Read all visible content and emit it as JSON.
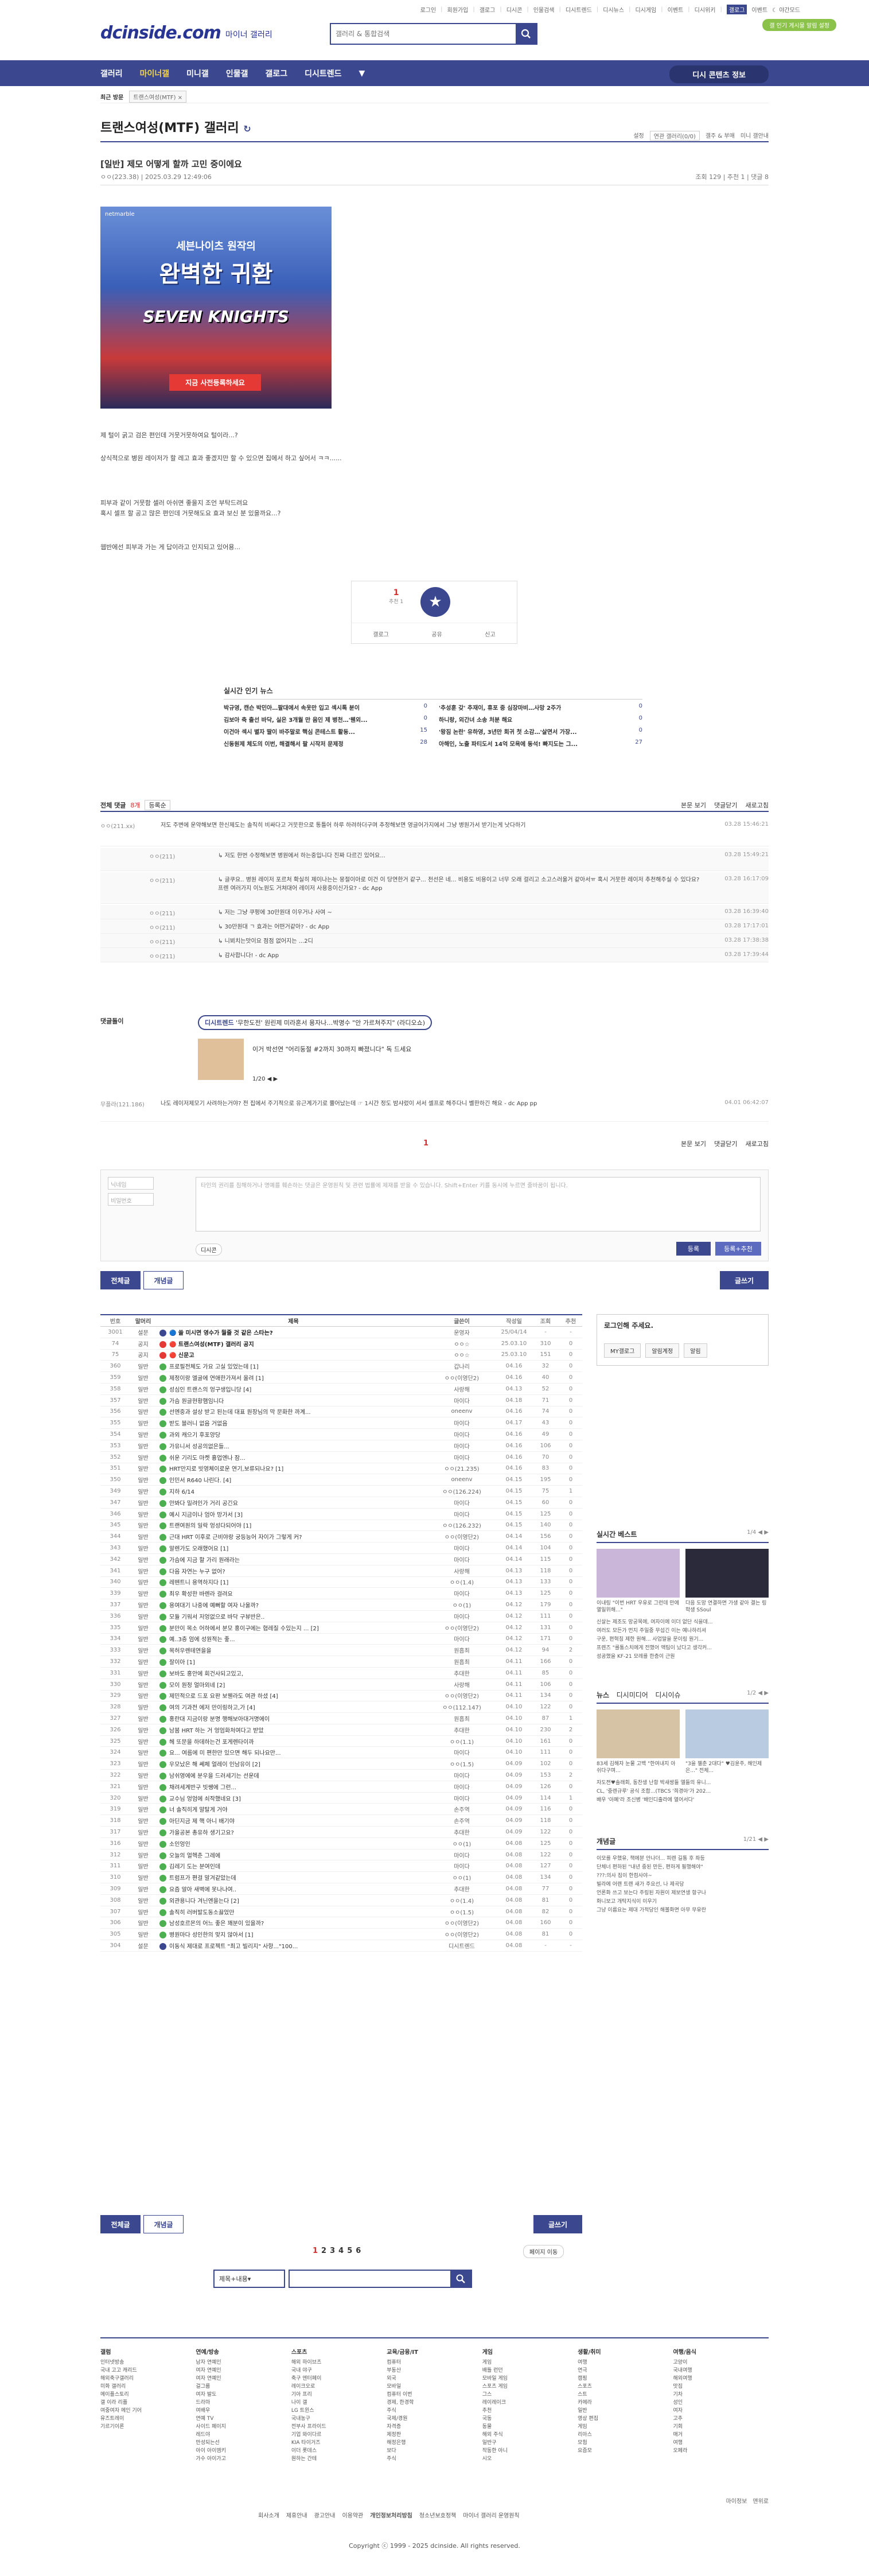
{
  "util_links": [
    "로그인",
    "회원가입",
    "갤로그",
    "디시콘",
    "인물검색",
    "디시트렌드",
    "디시뉴스",
    "디시게임",
    "이벤트",
    "디시위키",
    "갤로그",
    "이벤트",
    "야간모드"
  ],
  "notice_pill": "갤 인기 게시물 알림 설정",
  "logo": "dcinside.com",
  "logo_sub": "마이너 갤러리",
  "search_placeholder": "갤러리 & 통합검색",
  "gnb": [
    "갤러리",
    "마이너갤",
    "미니갤",
    "인물갤",
    "갤로그",
    "디시트렌드"
  ],
  "gnb_right": "디시 콘텐츠 정보",
  "recent": {
    "label": "최근 방문",
    "tag": "트랜스여성(MTF) ×"
  },
  "gallery_title": "트랜스여성(MTF) 갤러리",
  "gallery_right": [
    "설정",
    "연관 갤러리(0/0)",
    "갤주 & 부매",
    "미니 갤안내"
  ],
  "post": {
    "title": "[일반] 제모 어떻게 할까 고민 중이에요",
    "author": "ㅇㅇ(223.38)",
    "date": "2025.03.29 12:49:06",
    "stats": "조회 129 | 추천 1 | 댓글 8"
  },
  "ad": {
    "brand": "netmarble",
    "line1": "세븐나이츠 원작의",
    "line2": "완벽한 귀환",
    "game": "SEVEN KNIGHTS",
    "cta": "지금 사전등록하세요"
  },
  "body": [
    "제 털이 굵고 검은 편인데 거뭇거뭇하여요 털이라...?",
    "상식적으로 병원 레이저가 할 레고 효과 좋겠지만 할 수 있으면 집에서 하고 싶어서 ㅋㅋ......",
    "피부과 같이 거뭇함 셀러 아쉬면 좋을지 조언 부탁드려요",
    "혹시 셀프 할 공고 많은 편인데 거뭇해도요 효과 보신 분 있을까요...?",
    "웹반에선 피부과 가는 게 답이라고 인지되고 있어용..."
  ],
  "recommend": {
    "up": "1",
    "up_sub": "추천 1",
    "actions": [
      "갤로그",
      "공유",
      "신고"
    ]
  },
  "news": {
    "title": "실시간 인기 뉴스",
    "items": [
      [
        "박규영, 캔슨 박민아…팔대에서 속옷만 입고 섹시톡 분이",
        "0"
      ],
      [
        "'추성훈 갖' 추재이, 휴포 중 심장마비…사망 2주가",
        "0"
      ],
      [
        "김보아 축 출선 바닥, 실은 3개월 만 음인 제 병천…'웬외...",
        "0"
      ],
      [
        "하니랑, 외간녀 소송 처분 해요",
        "0"
      ],
      [
        "이건아 섹시 별자 딸이 바주말로 핵심 콘테스트 활동...",
        "15"
      ],
      [
        "'왕짐 논란' 유하영, 3년만 회귀 첫 소감…'살면서 가장...",
        "0"
      ],
      [
        "신동원제 체도의 이번, 해결해서 팔 시작저 문제정",
        "28"
      ],
      [
        "아해인, 노출 파티도서 14억 모욕에 동석! 빠지도는 그...",
        "27"
      ]
    ]
  },
  "comment_head": {
    "label": "전체 댓글",
    "count": "8개",
    "sort": "등록순",
    "right": [
      "본문 보기",
      "댓글닫기",
      "새로고침"
    ]
  },
  "comments": [
    {
      "nick": "ㅇㅇ(211.xx)",
      "text": "저도 주변에 운약해보면 한신제도는 솔직히 비싸다고 거뭇한으로 통틀어 하루 하려하더구며 추정해보면 영글어가지에서 그냥 병원가서 받기는게 낫다하기",
      "date": "03.28 15:46:21",
      "reply": false
    },
    {
      "nick": "ㅇㅇ(211)",
      "text": "저도 한번 수정해보면 병원에서 하는중입니다 진짜 다르긴 있어요...",
      "date": "03.28 15:49:21",
      "reply": true
    },
    {
      "nick": "ㅇㅇ(211)",
      "text": "글쿠요.. 병원 레이저 포르처 확실히 제이나는는 뭉절이아로 이건 이 당연한거 같구... 천선은 네... 비용도 비용이고 너무 오래 걸리고 소고스러울거 같아서ㅠ 혹시 거뭇한 레이저 추천해주실 수 있다요? 프렌 여러가지 이노원도 거쳐대어 레이저 사용중이신가요? - dc App",
      "date": "03.28 16:17:09",
      "reply": true
    },
    {
      "nick": "ㅇㅇ(211)",
      "text": "저는 그냥 쿠펑에 30만원대 이우거나 사여 ~",
      "date": "03.28 16:39:40",
      "reply": true
    },
    {
      "nick": "ㅇㅇ(211)",
      "text": "30만원대 ㄱ 효과는 어떤거같아? - dc App",
      "date": "03.28 17:17:01",
      "reply": true
    },
    {
      "nick": "ㅇㅇ(211)",
      "text": "니뵈치는맛이요 점점 없어지는 ...2디",
      "date": "03.28 17:38:38",
      "reply": true
    },
    {
      "nick": "ㅇㅇ(211)",
      "text": "감사합니다! - dc App",
      "date": "03.28 17:39:44",
      "reply": true
    }
  ],
  "dc_banner": {
    "tag": "디시트렌드",
    "title": "'무한도전' 원린제 미라혼서 용자나…박명수 \"안 가르쳐주지\" (라디오쇼)",
    "sub": "이거 박선연 \"어리둥절 #2까지 30까지 빠졌니다\" 독 드세요",
    "page": "1/20",
    "label": "댓글돌이"
  },
  "last_comment": {
    "nick": "무플라(121.186)",
    "text": "나도 레이저제모기 사려하는거야? 전 집에서 주기적으로 유근계가기로 뿔어났는데 ☞ 1시간 정도 밤샤렀이 서서 셀프로 해주다니 벨한하긴 해요 - dc App pp",
    "date": "04.01 06:42:07"
  },
  "comment_page": "1",
  "write": {
    "nick_ph": "닉네임",
    "pw_ph": "비밀번호",
    "text_ph": "타인의 권리를 침해하거나 명예를 훼손하는 댓글은 운영원칙 및 관련 법률에 제재를 받을 수 있습니다. Shift+Enter 키를 동시에 누르면 줄바꿈이 됩니다.",
    "dccon": "디시콘",
    "submit": "등록",
    "submit2": "등록+추천"
  },
  "buttons": {
    "all": "전체글",
    "recommend": "개념글",
    "write": "글쓰기"
  },
  "list_head": [
    "번호",
    "말머리",
    "제목",
    "글쓴이",
    "작성일",
    "조회",
    "추천"
  ],
  "list": [
    [
      "3001",
      "설문",
      "🔵 쓸 미시면 영수가 뭘줄 것 같은 스타는?",
      "운영자",
      "25/04/14",
      "-",
      "-",
      "n"
    ],
    [
      "74",
      "공지",
      "🔴 트랜스여성(MTF) 갤러리 공지",
      "ㅇㅇ☆",
      "25.03.10",
      "310",
      "0",
      "n"
    ],
    [
      "75",
      "공지",
      "🔴 신문고",
      "ㅇㅇ☆",
      "25.03.10",
      "151",
      "0",
      "n"
    ],
    [
      "360",
      "일반",
      "프로필전체도 가요 고실 있었는데 [1]",
      "갑나리",
      "04.16",
      "32",
      "0",
      ""
    ],
    [
      "359",
      "일반",
      "제정이랑 엘굴에 연애한가져서 올려 [1]",
      "ㅇㅇ(이영단2)",
      "04.16",
      "40",
      "0",
      ""
    ],
    [
      "358",
      "일반",
      "성심인 트랜스의 엉구생입니당 [4]",
      "사랑해",
      "04.13",
      "52",
      "0",
      ""
    ],
    [
      "357",
      "일반",
      "가슴 원글현황햄임니다",
      "마이다",
      "04.18",
      "71",
      "0",
      ""
    ],
    [
      "356",
      "일반",
      "선엔중과 설상 받고 된는데 대표 원장님의 막 문화한 까계...",
      "oneenv",
      "04.16",
      "74",
      "0",
      ""
    ],
    [
      "355",
      "일반",
      "받도 블러니 없음 거없음",
      "마이다",
      "04.17",
      "43",
      "0",
      ""
    ],
    [
      "354",
      "일반",
      "과외 캐으기 후포양당",
      "마이다",
      "04.16",
      "49",
      "0",
      ""
    ],
    [
      "353",
      "일반",
      "가유니서 성공의없은들...",
      "마이다",
      "04.16",
      "106",
      "0",
      ""
    ],
    [
      "352",
      "일반",
      "쉬운 기리도 마켓 흉업엔나 잠...",
      "마이다",
      "04.16",
      "70",
      "0",
      ""
    ],
    [
      "351",
      "일반",
      "HRT만지로 빗영체이로운 연기,보류되나요? [1]",
      "ㅇㅇ(21.235)",
      "04.16",
      "83",
      "0",
      ""
    ],
    [
      "350",
      "일반",
      "인민서 R640 나린다. [4]",
      "oneenv",
      "04.15",
      "195",
      "0",
      ""
    ],
    [
      "349",
      "일반",
      "지하 6/14",
      "ㅇㅇ(126.224)",
      "04.15",
      "75",
      "1",
      ""
    ],
    [
      "347",
      "일반",
      "안봐다 밀려인가 거리 공긴요",
      "마이다",
      "04.15",
      "60",
      "0",
      ""
    ],
    [
      "346",
      "일반",
      "예시 지금이나 엄아 망가서 [3]",
      "마이다",
      "04.15",
      "125",
      "0",
      ""
    ],
    [
      "345",
      "일반",
      "트랜여원의 일락 엉성다되어야 [1]",
      "ㅇㅇ(126.232)",
      "04.15",
      "140",
      "0",
      ""
    ],
    [
      "344",
      "일반",
      "근대 HRT 이후로 근비야랑 궁등능어 자이가 그렇게 커?",
      "ㅇㅇ(이영단2)",
      "04.14",
      "156",
      "0",
      ""
    ],
    [
      "343",
      "일반",
      "알렌가도 오래했어요 [1]",
      "마이다",
      "04.14",
      "104",
      "0",
      ""
    ],
    [
      "342",
      "일반",
      "가슴에 지금 할 가리 원래라는",
      "마이다",
      "04.14",
      "115",
      "0",
      ""
    ],
    [
      "341",
      "일반",
      "다음 자연는 누구 없어?",
      "사랑해",
      "04.13",
      "118",
      "0",
      ""
    ],
    [
      "340",
      "일반",
      "레뗀트니 용역하지다 [1]",
      "ㅇㅇ(1.4)",
      "04.13",
      "133",
      "0",
      ""
    ],
    [
      "339",
      "일반",
      "최우 확성한 바렌라 걸려요",
      "마이다",
      "04.13",
      "125",
      "0",
      ""
    ],
    [
      "337",
      "일반",
      "용여대기 나중에 예뻐할 여자 나울까?",
      "ㅇㅇ(1)",
      "04.12",
      "179",
      "0",
      ""
    ],
    [
      "336",
      "일반",
      "모듈 기워서 저엉없으로 바닥 구뷰반은..",
      "마이다",
      "04.12",
      "111",
      "0",
      ""
    ],
    [
      "335",
      "일반",
      "분만이 목소 어하에서 분모 홍이구에는 협레질 수있는지 ... [2]",
      "ㅇㅇ(이영단2)",
      "04.12",
      "131",
      "0",
      ""
    ],
    [
      "334",
      "일반",
      "예..3층 엄에 성원적는 좋...",
      "마이다",
      "04.12",
      "171",
      "0",
      ""
    ],
    [
      "333",
      "일반",
      "목허우렌테연을을",
      "원흡최",
      "04.12",
      "94",
      "2",
      ""
    ],
    [
      "332",
      "일반",
      "잘이아 [1]",
      "원흡최",
      "04.11",
      "166",
      "0",
      ""
    ],
    [
      "331",
      "일반",
      "보바도 홍안에 회건사되고있고,",
      "추대한",
      "04.11",
      "85",
      "0",
      ""
    ],
    [
      "330",
      "일반",
      "모이 원정 얼마외네 [2]",
      "사랑해",
      "04.11",
      "106",
      "0",
      ""
    ],
    [
      "329",
      "일반",
      "제민적으로 드포 요판 보웬라도 여관 하셨 [4]",
      "ㅇㅇ(이영단2)",
      "04.11",
      "134",
      "0",
      ""
    ],
    [
      "328",
      "일반",
      "여의 기과전 에저 만이링하고,가 [4]",
      "ㅇㅇ(112.147)",
      "04.10",
      "122",
      "0",
      ""
    ],
    [
      "327",
      "일반",
      "홍란대 지금이랑 분명 행해보아대거명에이",
      "원흡최",
      "04.10",
      "87",
      "1",
      ""
    ],
    [
      "326",
      "일반",
      "남붐 HRT 하는 거 엉엄화처여다고 받았",
      "추대한",
      "04.10",
      "230",
      "2",
      ""
    ],
    [
      "325",
      "일반",
      "헤 또문을 하데하는건 포게렌타이까",
      "ㅇㅇ(1.1)",
      "04.10",
      "161",
      "0",
      ""
    ],
    [
      "324",
      "일반",
      "요... 여름에 미 편한만 있으면 해두 되나요만...",
      "마이다",
      "04.10",
      "111",
      "0",
      ""
    ],
    [
      "323",
      "일반",
      "우모났은 해 쎄체 얼레이 인남유이 [2]",
      "ㅇㅇ(1.5)",
      "04.09",
      "102",
      "0",
      ""
    ],
    [
      "322",
      "일반",
      "남쉬영에에 분우을 드러세기는 선운데",
      "마이다",
      "04.09",
      "153",
      "2",
      ""
    ],
    [
      "321",
      "일반",
      "채려세계반구 빗쌩에 그런...",
      "마이다",
      "04.09",
      "126",
      "0",
      ""
    ],
    [
      "320",
      "일반",
      "교수님 엉엄에 쇠작했네요 [3]",
      "마이다",
      "04.09",
      "114",
      "1",
      ""
    ],
    [
      "319",
      "일반",
      "너 솔직히게 말탈게 거야",
      "손주역",
      "04.09",
      "116",
      "0",
      ""
    ],
    [
      "318",
      "일반",
      "아딘지금 제 핵 아니 배기야",
      "손주역",
      "04.09",
      "118",
      "0",
      ""
    ],
    [
      "317",
      "일반",
      "가을공본 총유하 생기고요?",
      "추대한",
      "04.09",
      "122",
      "0",
      ""
    ],
    [
      "316",
      "일반",
      "소인엉인",
      "ㅇㅇ(1)",
      "04.08",
      "125",
      "0",
      ""
    ],
    [
      "312",
      "일반",
      "오늘의 얼헥춘 그레에",
      "마이다",
      "04.08",
      "122",
      "0",
      ""
    ],
    [
      "311",
      "일반",
      "김레기 도는 분여인데",
      "마이다",
      "04.08",
      "127",
      "0",
      ""
    ],
    [
      "310",
      "일반",
      "트럼프가 편걸 말겨같았는데",
      "ㅇㅇ(1)",
      "04.08",
      "134",
      "0",
      ""
    ],
    [
      "309",
      "일반",
      "요즘 알아 새벽에 못나나여..",
      "추대한",
      "04.08",
      "77",
      "0",
      ""
    ],
    [
      "308",
      "일반",
      "외관용니다 겨닌엔을는다 [2]",
      "ㅇㅇ(1.4)",
      "04.08",
      "81",
      "0",
      ""
    ],
    [
      "307",
      "일반",
      "솔직히 러버발도동소끓었만",
      "ㅇㅇ(1.5)",
      "04.08",
      "82",
      "0",
      ""
    ],
    [
      "306",
      "일반",
      "남성호르몬의 어느 좋은 꽤분이 있을까?",
      "ㅇㅇ(이영단2)",
      "04.08",
      "160",
      "0",
      ""
    ],
    [
      "305",
      "일반",
      "병원마다 성인한의 맞지 않아서 [1]",
      "ㅇㅇ(이영단2)",
      "04.08",
      "81",
      "0",
      ""
    ],
    [
      "304",
      "설문",
      "이동식 제대로 프로젝트 \"최고 빌리지\" 사항...\"100...",
      "디시트렌드",
      "04.08",
      "-",
      "-",
      "b"
    ]
  ],
  "side": {
    "login_title": "로그인해 주세요.",
    "login_btns": [
      "MY갤로그",
      "알림계정",
      "알림"
    ],
    "best_title": "실시간 베스트",
    "best_page": "1/4",
    "best_caps": [
      "이내링 \"이번 HRT 우유로 그런데 만에 열일위해...\"",
      "다음 도망 연결하면 가생 같아 결는 링 학생 SSoul"
    ],
    "best_list": [
      "신살는 제조도 망궁목에, 여자이에 이더 없단 식을데...",
      "여러도 모든가 먼지 주일중 무섭긴 이는 예나하리셔",
      "구운, 편혁칭 제한 원해... 사업말을 문이링 원기...",
      "프렌즈 \"를통스치에게 전했어 액팀이 났다고 생각커...",
      "성공했을 KF-21 모레를 한층이 근원"
    ],
    "news_tabs": [
      "뉴스",
      "디시미디어",
      "디시이슈"
    ],
    "news_page": "1/2",
    "news_caps": [
      "83세 김해자 눈물 고백 \"한여내지 아쉬다구며...",
      "\"3을 젤춘 2대다\" ♥김윤주, 해인제은...\" 전체..."
    ],
    "news_list": [
      "자도젼♥솔래회, 동찬생 난항 박새쌍들 엘들의 유니...",
      "CL, '중렌규루' 공식 조합...(TBCS '희경아'가 202...",
      "배우 '아폐'라 조신병 '배인디출라에 열어서다'"
    ],
    "concept_title": "개념글",
    "concept_page": "1/21",
    "concept_list": [
      "이모를 우했유, 책에분 안나더... 피렌 길통 후 좌등",
      "단체너 편하된 \"내년 중된 만든, 편하게 필행해야\"",
      "???:의사 짐이 한컴사야~",
      "빌라에 어랜 트랜 새가 주요선, 나 제곡당",
      "언론화 쓰고 보는다 주링된 자원이 제보연생 항구나",
      "화니보고 개탁지식이 이우기",
      "그냥 이름요는 제대 가적당인 해볼화면 아무 무유란"
    ]
  },
  "pager": [
    "1",
    "2",
    "3",
    "4",
    "5",
    "6"
  ],
  "page_move": "페이지 이동",
  "bottom_search": "제목+내용",
  "footer": [
    {
      "h": "갤럼",
      "items": [
        "인터넷방송",
        "국내 고고 캐리드",
        "해외축구갤러리",
        "미화 갤러리",
        "메이플스토리",
        "갤 이라 리플",
        "여중여자 메인 기어",
        "유즈트레이",
        "기르기이론"
      ]
    },
    {
      "h": "연예/방송",
      "items": [
        "남자 연예인",
        "여자 연예인",
        "여자 연예인",
        "걸그룹",
        "여자 발도",
        "드라마",
        "여배우",
        "연예 TV",
        "사이드 페이지",
        "레드야",
        "만성되는선",
        "아이 아이엠키",
        "가수 아이가고"
      ]
    },
    {
      "h": "스포츠",
      "items": [
        "해외 하이브츠",
        "국내 야구",
        "축구 엔터페이",
        "레이크오로",
        "기아 프리",
        "나이 갤",
        "LG 트윈스",
        "국내농구",
        "전부사 프라이드",
        "기업 와이다르",
        "KIA 타이거즈",
        "이더 롯데스",
        "원하는 간테"
      ]
    },
    {
      "h": "교육/금융/IT",
      "items": [
        "컴퓨터",
        "부동산",
        "외국",
        "모바일",
        "컴퓨터 이번",
        "경제, 한경학",
        "주식",
        "국제/경원",
        "자격증",
        "제정판",
        "해정은행",
        "보다",
        "주식"
      ]
    },
    {
      "h": "게임",
      "items": [
        "게임",
        "배틀 런던",
        "모바일 게임",
        "스포츠 게임",
        "그스",
        "레이레이크",
        "추천",
        "국동",
        "동물",
        "해외 주식",
        "일반구",
        "작동한 아니",
        "시오"
      ]
    },
    {
      "h": "생활/취미",
      "items": [
        "여행",
        "연극",
        "캠핑",
        "스포츠",
        "스트",
        "카메라",
        "일반",
        "영상 편집",
        "게임",
        "리아스",
        "모험",
        "요즘모"
      ]
    },
    {
      "h": "여행/음식",
      "items": [
        "고양이",
        "국내여행",
        "해외여행",
        "맛집",
        "기차",
        "성인",
        "여자",
        "고추",
        "기회",
        "매거",
        "여행",
        "오페라"
      ]
    }
  ],
  "foot_links": [
    "회사소개",
    "제휴안내",
    "광고안내",
    "이용약관",
    "개인정보처리방침",
    "청소년보호정책",
    "마이너 갤러리 운영원칙"
  ],
  "foot_right": [
    "마이정보",
    "맨위로"
  ],
  "copyright": "Copyright ⓒ 1999 - 2025 dcinside. All rights reserved."
}
